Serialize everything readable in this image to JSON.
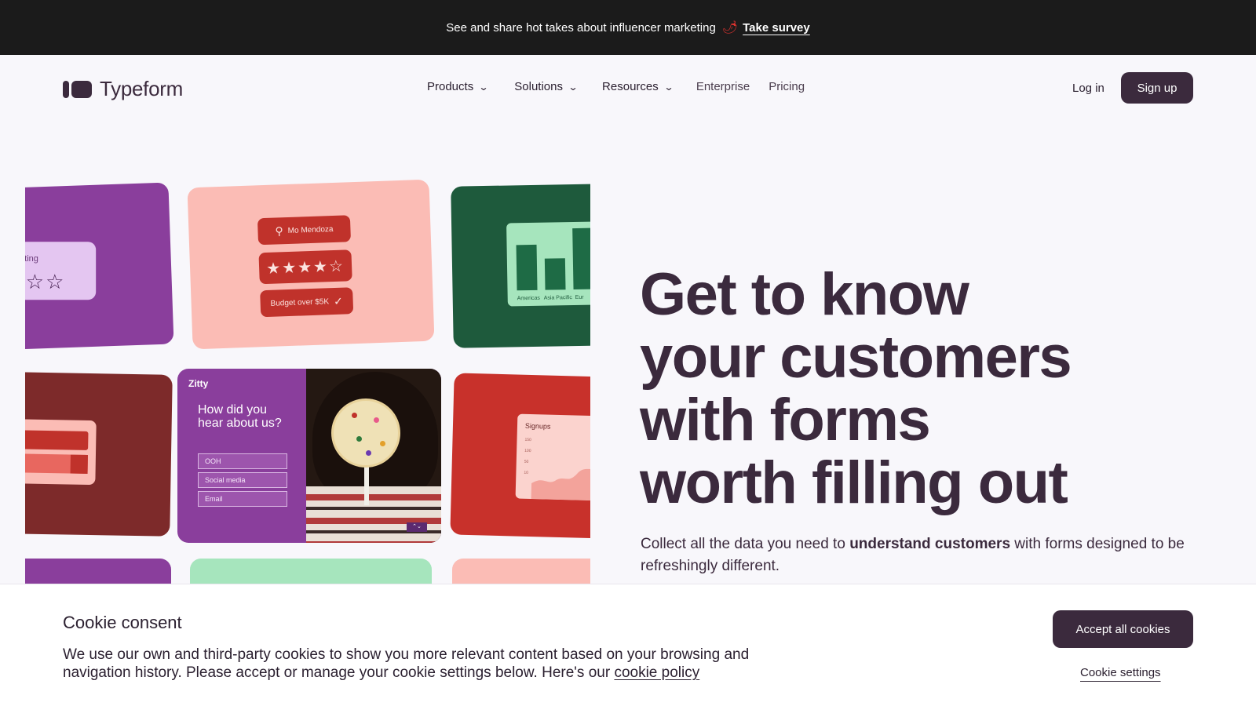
{
  "banner": {
    "text": "See and share hot takes about influencer marketing",
    "emoji": "🌶",
    "link": "Take survey"
  },
  "header": {
    "logo_text": "Typeform",
    "nav": [
      {
        "label": "Products",
        "has_dropdown": true
      },
      {
        "label": "Solutions",
        "has_dropdown": true
      },
      {
        "label": "Resources",
        "has_dropdown": true
      },
      {
        "label": "Enterprise",
        "has_dropdown": false
      },
      {
        "label": "Pricing",
        "has_dropdown": false
      }
    ],
    "login": "Log in",
    "signup": "Sign up"
  },
  "collage": {
    "rating_label": "erage rating",
    "rating_stars": "★★☆☆",
    "contact_name": "Mo Mendoza",
    "stars_pill": "★★★★☆",
    "budget_pill": "Budget over $5K",
    "chart_axis": [
      "Americas",
      "Asia Pacific",
      "Eur"
    ],
    "survey_brand": "Zitty",
    "survey_question": "How did you hear about us?",
    "survey_options": [
      "OOH",
      "Social media",
      "Email"
    ],
    "signups_title": "Signups",
    "signups_ticks": [
      "150",
      "100",
      "50",
      "10"
    ]
  },
  "hero": {
    "title_lines": [
      "Get to know",
      "your customers",
      "with forms",
      "worth filling out"
    ],
    "sub_pre": "Collect all the data you need to ",
    "sub_bold": "understand customers",
    "sub_post": " with forms designed to be refreshingly different."
  },
  "cookie": {
    "title": "Cookie consent",
    "text": "We use our own and third-party cookies to show you more relevant content based on your browsing and navigation history. Please accept or manage your cookie settings below. Here's our ",
    "policy_link": "cookie policy",
    "accept": "Accept all cookies",
    "settings": "Cookie settings"
  },
  "colors": {
    "brand": "#3b2a3d",
    "banner_bg": "#1b1b1b",
    "page_bg": "#f8f7fb"
  }
}
